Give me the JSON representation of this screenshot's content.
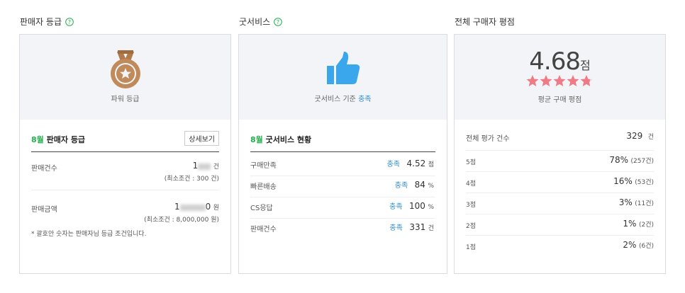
{
  "seller_grade": {
    "title": "판매자 등급",
    "badge_caption": "파워 등급",
    "month": "8월",
    "header_label": "판매자 등급",
    "detail_button": "상세보기",
    "rows": [
      {
        "label": "판매건수",
        "value_prefix": "1",
        "value_suffix": "",
        "unit": "건",
        "sub": "(최소조건 : 300 건)"
      },
      {
        "label": "판매금액",
        "value_prefix": "1",
        "value_suffix": "0",
        "unit": "원",
        "sub": "(최소조건 : 8,000,000 원)"
      }
    ],
    "note": "* 괄호안 숫자는 판매자님 등급 조건입니다."
  },
  "good_service": {
    "title": "굿서비스",
    "caption_prefix": "굿서비스 기준",
    "caption_status": "충족",
    "month": "8월",
    "header_label": "굿서비스 현황",
    "rows": [
      {
        "label": "구매만족",
        "status": "충족",
        "value": "4.52",
        "unit": "점"
      },
      {
        "label": "빠른배송",
        "status": "충족",
        "value": "84",
        "unit": "%"
      },
      {
        "label": "CS응답",
        "status": "충족",
        "value": "100",
        "unit": "%"
      },
      {
        "label": "판매건수",
        "status": "충족",
        "value": "331",
        "unit": "건"
      }
    ]
  },
  "rating": {
    "title": "전체 구매자 평점",
    "score": "4.68",
    "score_unit": "점",
    "score_fraction": 0.936,
    "caption": "평균 구매 평점",
    "total_label": "전체 평가 건수",
    "total_value": "329",
    "total_unit": "건",
    "rows": [
      {
        "label": "5점",
        "percent": "78%",
        "count": "(257건)"
      },
      {
        "label": "4점",
        "percent": "16%",
        "count": "(53건)"
      },
      {
        "label": "3점",
        "percent": "3%",
        "count": "(11건)"
      },
      {
        "label": "2점",
        "percent": "1%",
        "count": "(2건)"
      },
      {
        "label": "1점",
        "percent": "2%",
        "count": "(6건)"
      }
    ]
  },
  "colors": {
    "accent_green": "#22b14c",
    "accent_blue": "#2a8bd6",
    "thumb_blue": "#3aa7ec",
    "medal_brown": "#c08a5a",
    "star_pink": "#f07b86"
  }
}
